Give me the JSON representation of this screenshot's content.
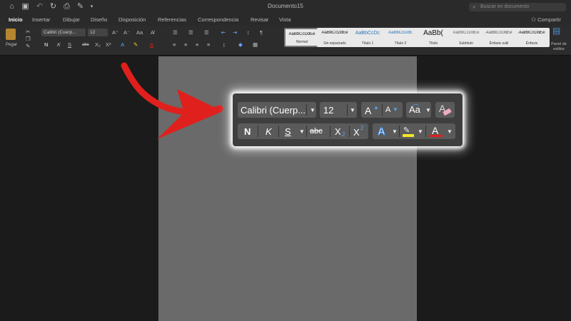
{
  "window": {
    "title": "Documento15"
  },
  "search": {
    "placeholder": "Buscar en documento"
  },
  "tabs": [
    "Inicio",
    "Insertar",
    "Dibujar",
    "Diseño",
    "Disposición",
    "Referencias",
    "Correspondencia",
    "Revisar",
    "Vista"
  ],
  "share_label": "Compartir",
  "ribbon": {
    "paste_label": "Pegar",
    "font_name": "Calibri (Cuerp...",
    "font_size": "12",
    "styles": [
      {
        "preview": "AaBbCcDdEe",
        "name": "Normal"
      },
      {
        "preview": "AaBbCcDdEe",
        "name": "Sin espaciado"
      },
      {
        "preview": "AaBbCcDc",
        "name": "Título 1"
      },
      {
        "preview": "AaBbCcDdE",
        "name": "Título 2"
      },
      {
        "preview": "AaBb(",
        "name": "Título"
      },
      {
        "preview": "AaBbCcDdEe",
        "name": "Subtítulo"
      },
      {
        "preview": "AaBbCcDdEe",
        "name": "Énfasis sutil"
      },
      {
        "preview": "AaBbCcDdEe",
        "name": "Énfasis"
      }
    ],
    "styles_pane_label": "Panel de estilos"
  },
  "zoom": {
    "font_name": "Calibri (Cuerp...",
    "font_size": "12",
    "grow_font": "A",
    "shrink_font": "A",
    "change_case": "Aa",
    "bold": "N",
    "italic": "K",
    "underline": "S",
    "strikethrough": "abc",
    "subscript": "X",
    "subscript_mark": "2",
    "superscript": "X",
    "superscript_mark": "2",
    "text_effects": "A",
    "font_color": "A"
  },
  "colors": {
    "accent_red": "#e0201c",
    "highlight_yellow": "#f4e52b",
    "effect_blue": "#2f7fd8",
    "page_gray": "#6a6a6a"
  },
  "icons": [
    "home-icon",
    "save-icon",
    "undo-icon",
    "redo-icon",
    "print-icon",
    "search-icon",
    "paste-icon",
    "eraser-icon",
    "red-arrow-icon"
  ]
}
